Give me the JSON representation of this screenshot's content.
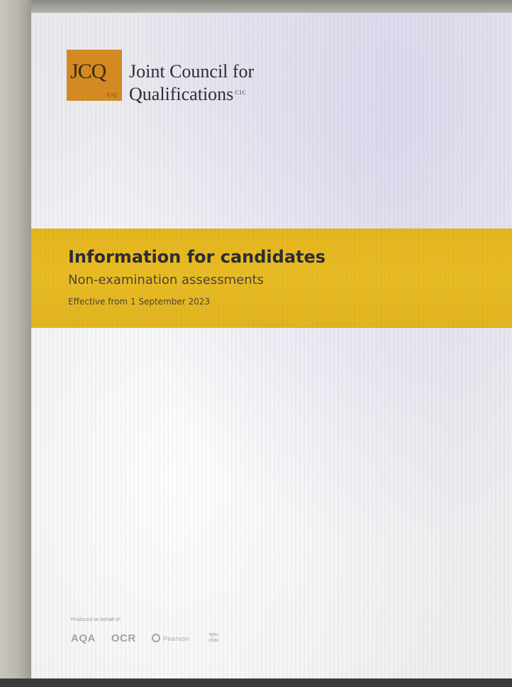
{
  "logo": {
    "letters": "JCQ",
    "cic_small": "CIC",
    "name_line1": "Joint Council for",
    "name_line2": "Qualifications",
    "name_suffix": "CIC"
  },
  "band": {
    "title": "Information for candidates",
    "subtitle": "Non-examination assessments",
    "effective": "Effective from 1 September 2023"
  },
  "footer": {
    "produced_label": "Produced on behalf of:",
    "partners": [
      "AQA",
      "OCR",
      "Pearson",
      "wjec cbac"
    ]
  },
  "colors": {
    "logo_orange": "#d58a1f",
    "band_yellow": "#e9bc23"
  }
}
